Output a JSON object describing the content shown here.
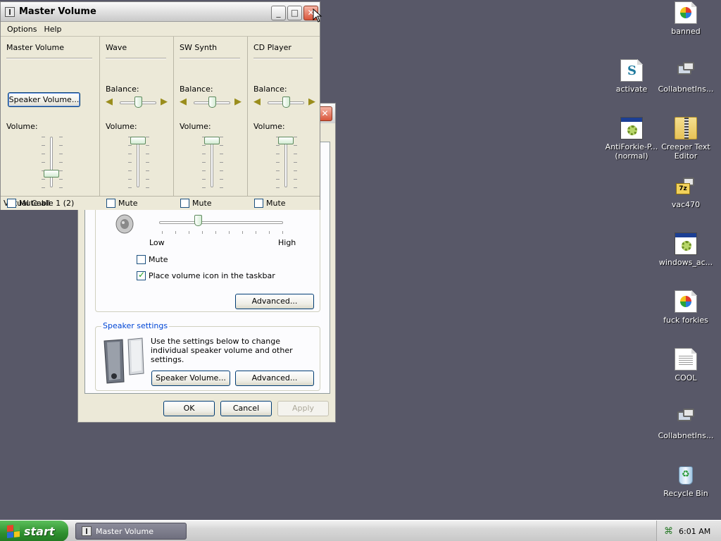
{
  "desktop": {
    "icons": [
      {
        "label": "banned",
        "icon": "image-icon"
      },
      {
        "label": "activate",
        "icon": "script-icon"
      },
      {
        "label": "CollabnetIns...",
        "icon": "installer-icon"
      },
      {
        "label": "AntiForkie-P... (normal)",
        "icon": "app-window-icon"
      },
      {
        "label": "Creeper Text Editor",
        "icon": "zip-folder-icon"
      },
      {
        "label": "vac470",
        "icon": "7zip-archive-icon"
      },
      {
        "label": "windows_ac...",
        "icon": "app-window-icon"
      },
      {
        "label": "fuck forkies",
        "icon": "image-icon"
      },
      {
        "label": "COOL",
        "icon": "text-document-icon"
      },
      {
        "label": "CollabnetIns...",
        "icon": "installer-icon"
      },
      {
        "label": "Recycle Bin",
        "icon": "recycle-bin-icon"
      }
    ]
  },
  "master_volume": {
    "title": "Master Volume",
    "menu": [
      "Options",
      "Help"
    ],
    "master": {
      "heading": "Master Volume",
      "speaker_button": "Speaker Volume...",
      "volume_label": "Volume:",
      "volume_level": 0.27,
      "mute_label": "Mute all",
      "muted": false
    },
    "channels": [
      {
        "name": "Wave",
        "balance_label": "Balance:",
        "balance": 0.5,
        "volume_label": "Volume:",
        "volume_level": 1.0,
        "mute_label": "Mute",
        "muted": false
      },
      {
        "name": "SW Synth",
        "balance_label": "Balance:",
        "balance": 0.5,
        "volume_label": "Volume:",
        "volume_level": 1.0,
        "mute_label": "Mute",
        "muted": false
      },
      {
        "name": "CD Player",
        "balance_label": "Balance:",
        "balance": 0.5,
        "volume_label": "Volume:",
        "volume_level": 1.0,
        "mute_label": "Mute",
        "muted": false
      }
    ],
    "status": "Virtual Cable 1 (2)"
  },
  "sound_dialog": {
    "device_volume": {
      "low_label": "Low",
      "high_label": "High",
      "level": 0.3,
      "mute_label": "Mute",
      "muted": false,
      "taskbar_icon_label": "Place volume icon in the taskbar",
      "taskbar_icon_checked": true,
      "advanced_button": "Advanced..."
    },
    "speaker_settings": {
      "title": "Speaker settings",
      "description": "Use the settings below to change individual speaker volume and other settings.",
      "speaker_volume_button": "Speaker Volume...",
      "advanced_button": "Advanced..."
    },
    "buttons": {
      "ok": "OK",
      "cancel": "Cancel",
      "apply": "Apply"
    }
  },
  "taskbar": {
    "start_label": "start",
    "task_label": "Master Volume",
    "clock": "6:01 AM"
  }
}
